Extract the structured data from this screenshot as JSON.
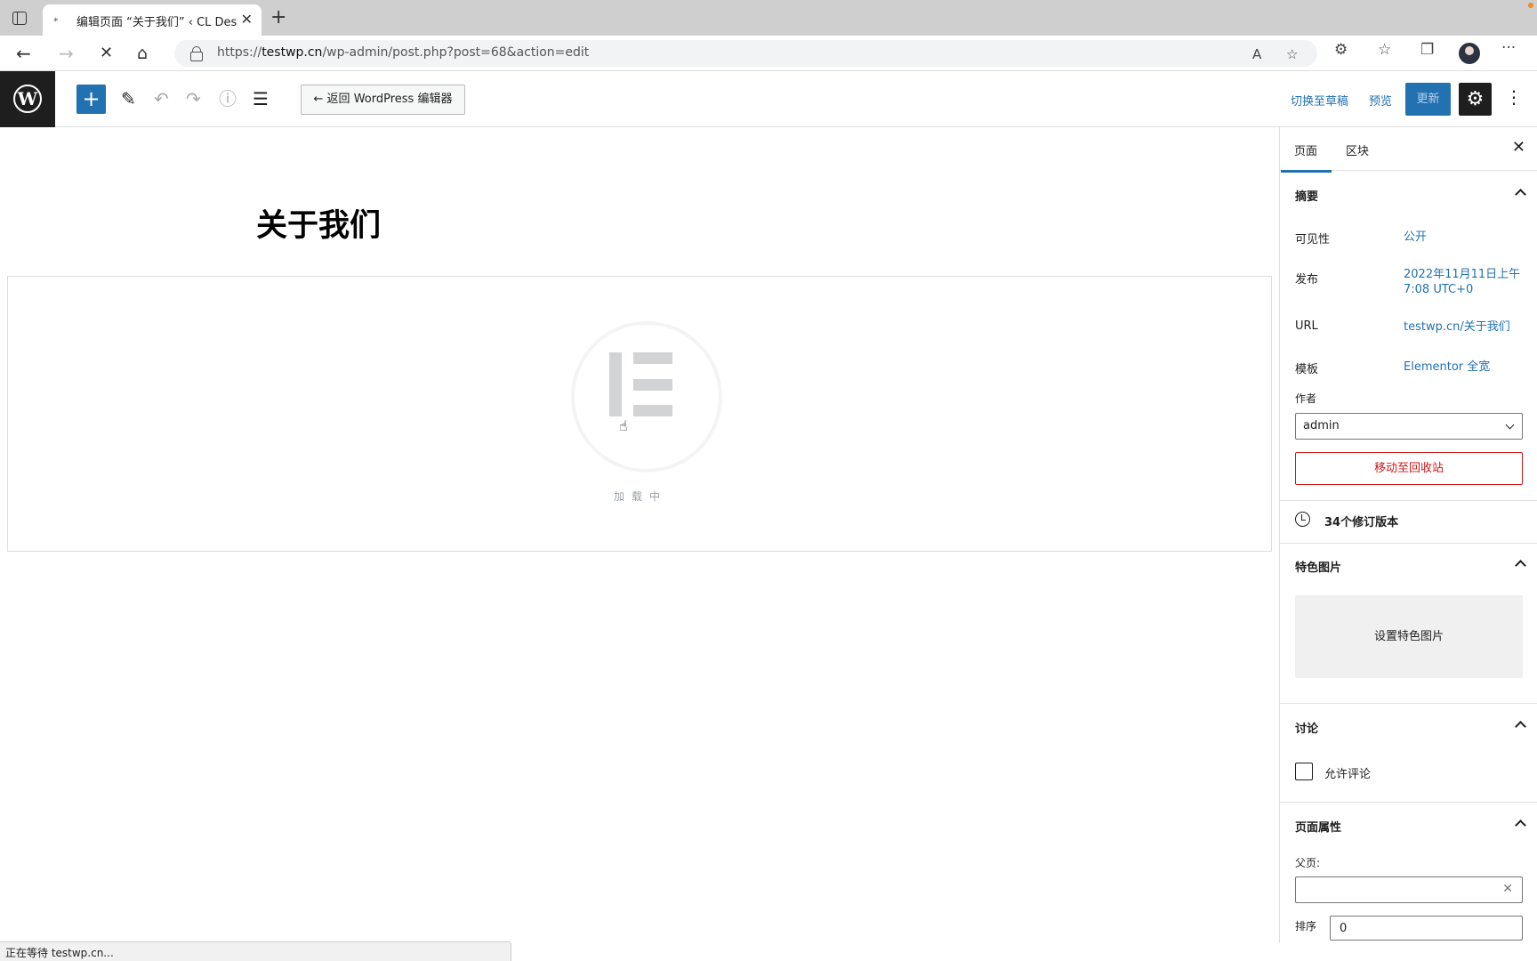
{
  "browser": {
    "tab_title": "编辑页面 “关于我们” ‹ CL Desi",
    "tab_favicon": "⁎",
    "url_domain": "testwp.cn",
    "url_prefix": "https://",
    "url_path": "/wp-admin/post.php?post=68&action=edit",
    "status_text": "正在等待 testwp.cn..."
  },
  "toolbar": {
    "back_to_wp_label": "← 返回 WordPress 编辑器",
    "switch_draft_label": "切换至草稿",
    "preview_label": "预览",
    "update_label": "更新"
  },
  "editor": {
    "page_title": "关于我们",
    "loading_text": "加载中"
  },
  "sidebar": {
    "tabs": [
      {
        "label": "页面"
      },
      {
        "label": "区块"
      }
    ],
    "summary": {
      "title": "摘要",
      "visibility_label": "可见性",
      "visibility_value": "公开",
      "publish_label": "发布",
      "publish_value_line1": "2022年11月11日上午",
      "publish_value_line2": "7:08 UTC+0",
      "url_label": "URL",
      "url_value": "testwp.cn/关于我们",
      "template_label": "模板",
      "template_value": "Elementor 全宽",
      "author_label": "作者",
      "author_value": "admin",
      "trash_label": "移动至回收站"
    },
    "revisions_label": "34个修订版本",
    "featured_image": {
      "title": "特色图片",
      "set_label": "设置特色图片"
    },
    "discussion": {
      "title": "讨论",
      "allow_comments_label": "允许评论"
    },
    "page_attributes": {
      "title": "页面属性",
      "parent_label": "父页:",
      "order_label": "排序",
      "order_value": "0"
    }
  },
  "colors": {
    "wp_blue": "#2271b1",
    "danger": "#cc1818",
    "dark": "#1e1e1e"
  }
}
